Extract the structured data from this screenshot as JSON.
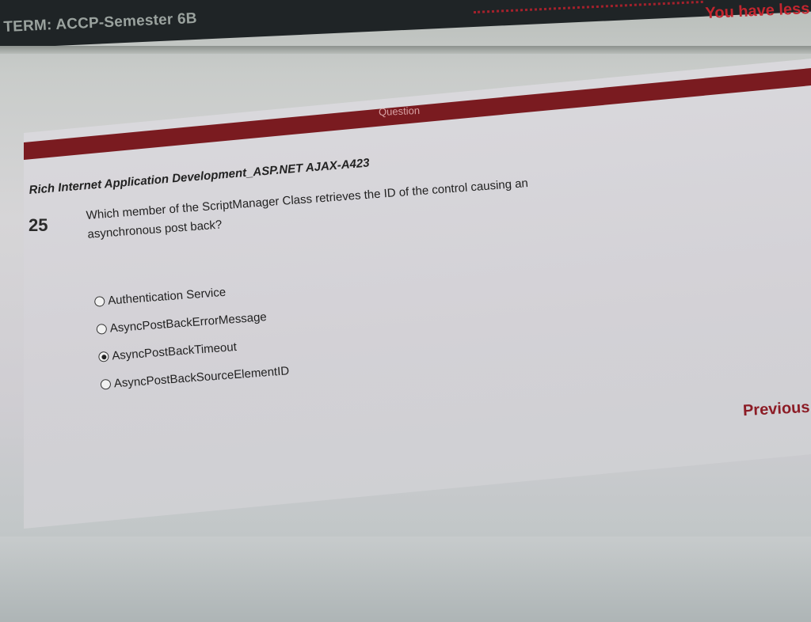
{
  "header": {
    "term": "TERM: ACCP-Semester 6B",
    "time_warning": "You have less tha"
  },
  "question_panel": {
    "header_label": "Question",
    "subject": "Rich Internet Application Development_ASP.NET AJAX-A423",
    "number": "25",
    "text": "Which member of the ScriptManager Class retrieves the ID of the control causing an asynchronous post back?",
    "options": [
      {
        "label": "Authentication Service",
        "selected": false
      },
      {
        "label": "AsyncPostBackErrorMessage",
        "selected": false
      },
      {
        "label": "AsyncPostBackTimeout",
        "selected": true
      },
      {
        "label": "AsyncPostBackSourceElementID",
        "selected": false
      }
    ],
    "selected_index": 2
  },
  "navigation": {
    "previous_label": "Previous"
  },
  "colors": {
    "accent": "#7a1b20",
    "warning": "#c3262f",
    "header_bg": "#1f2426"
  }
}
